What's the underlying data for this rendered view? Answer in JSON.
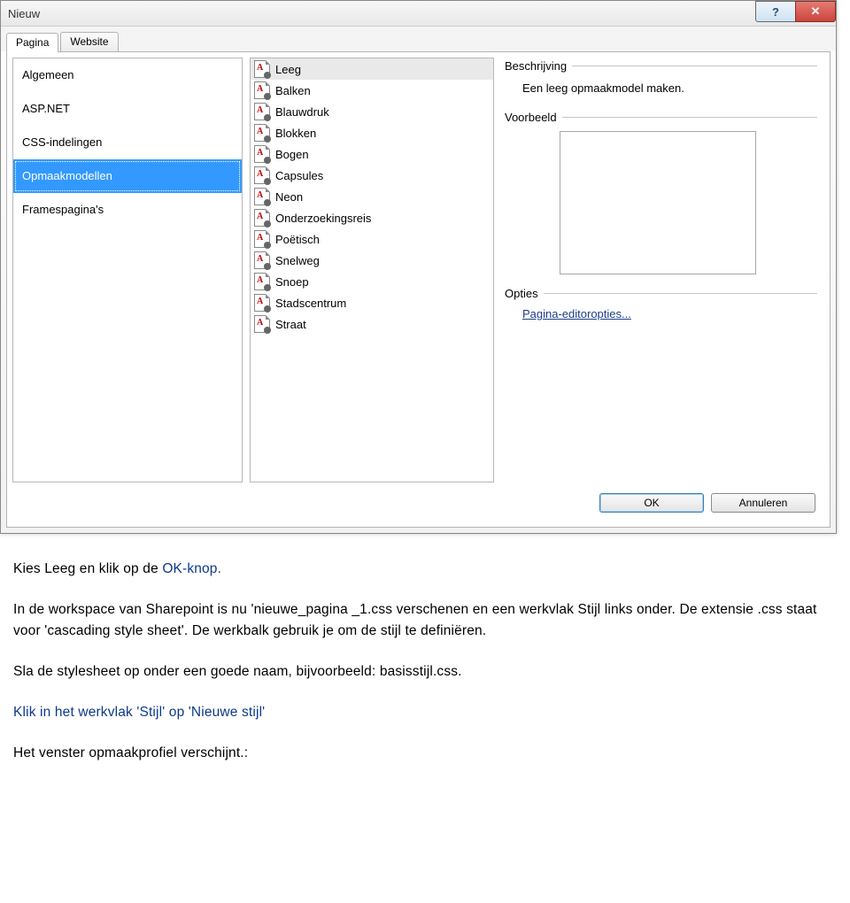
{
  "dialog": {
    "title": "Nieuw",
    "tabs": [
      "Pagina",
      "Website"
    ],
    "active_tab": 0,
    "categories": [
      {
        "label": "Algemeen"
      },
      {
        "label": "ASP.NET"
      },
      {
        "label": "CSS-indelingen"
      },
      {
        "label": "Opmaakmodellen",
        "selected": true
      },
      {
        "label": "Framespagina's"
      }
    ],
    "templates": [
      {
        "label": "Leeg",
        "selected": true
      },
      {
        "label": "Balken"
      },
      {
        "label": "Blauwdruk"
      },
      {
        "label": "Blokken"
      },
      {
        "label": "Bogen"
      },
      {
        "label": "Capsules"
      },
      {
        "label": "Neon"
      },
      {
        "label": "Onderzoekingsreis"
      },
      {
        "label": "Poëtisch"
      },
      {
        "label": "Snelweg"
      },
      {
        "label": "Snoep"
      },
      {
        "label": "Stadscentrum"
      },
      {
        "label": "Straat"
      }
    ],
    "right": {
      "desc_label": "Beschrijving",
      "desc_text": "Een leeg opmaakmodel maken.",
      "preview_label": "Voorbeeld",
      "options_label": "Opties",
      "options_link": "Pagina-editoropties..."
    },
    "buttons": {
      "ok": "OK",
      "cancel": "Annuleren"
    }
  },
  "doc": {
    "p1_a": "Kies Leeg en klik op de ",
    "p1_b": "OK-knop.",
    "p2": "In de workspace van Sharepoint is nu 'nieuwe_pagina _1.css verschenen en een werkvlak Stijl links onder. De extensie .css staat voor 'cascading style sheet'. De werkbalk gebruik je om de stijl te definiëren.",
    "p3": "Sla de stylesheet op onder een goede naam, bijvoorbeeld: basisstijl.css.",
    "p4": "Klik in het werkvlak 'Stijl' op 'Nieuwe stijl'",
    "p5": "Het venster opmaakprofiel verschijnt.:"
  }
}
